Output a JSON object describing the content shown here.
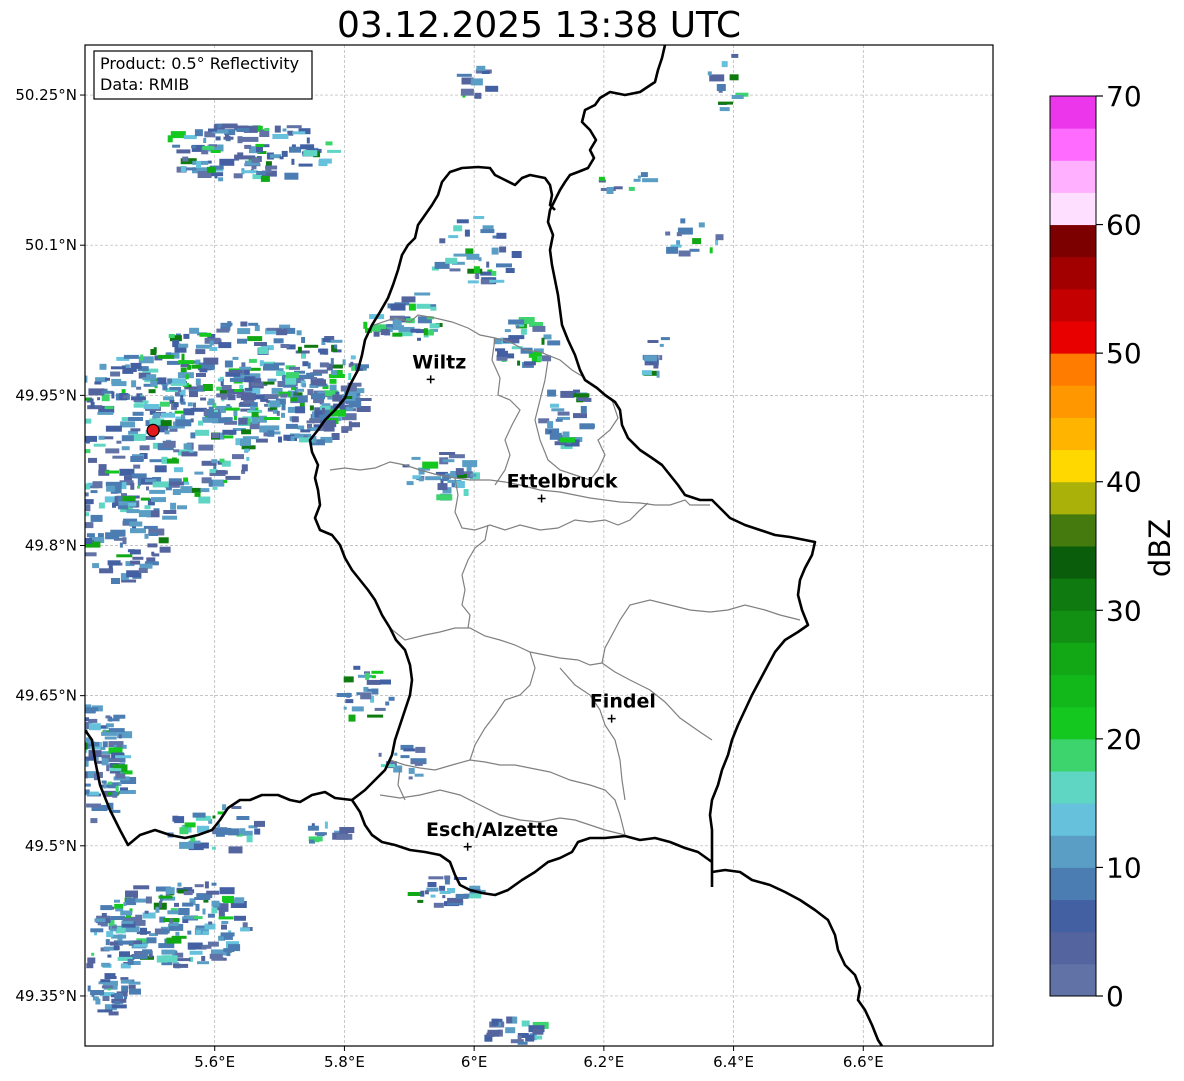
{
  "title": "03.12.2025 13:38 UTC",
  "info_box": {
    "line1": "Product: 0.5° Reflectivity",
    "line2": "Data: RMIB"
  },
  "axes": {
    "lon_range": [
      5.4,
      6.8
    ],
    "lat_range": [
      49.3,
      50.3
    ],
    "x_ticks": [
      {
        "value": 5.6,
        "label": "5.6°E"
      },
      {
        "value": 5.8,
        "label": "5.8°E"
      },
      {
        "value": 6.0,
        "label": "6°E"
      },
      {
        "value": 6.2,
        "label": "6.2°E"
      },
      {
        "value": 6.4,
        "label": "6.4°E"
      },
      {
        "value": 6.6,
        "label": "6.6°E"
      }
    ],
    "y_ticks": [
      {
        "value": 50.25,
        "label": "50.25°N"
      },
      {
        "value": 50.1,
        "label": "50.1°N"
      },
      {
        "value": 49.95,
        "label": "49.95°N"
      },
      {
        "value": 49.8,
        "label": "49.8°N"
      },
      {
        "value": 49.65,
        "label": "49.65°N"
      },
      {
        "value": 49.5,
        "label": "49.5°N"
      },
      {
        "value": 49.35,
        "label": "49.35°N"
      }
    ],
    "grid": true
  },
  "cities": [
    {
      "name": "Wiltz",
      "lon": 5.933,
      "lat": 49.966
    },
    {
      "name": "Ettelbruck",
      "lon": 6.104,
      "lat": 49.847
    },
    {
      "name": "Findel",
      "lon": 6.212,
      "lat": 49.627
    },
    {
      "name": "Esch/Alzette",
      "lon": 5.99,
      "lat": 49.499
    }
  ],
  "radar_site": {
    "lon": 5.505,
    "lat": 49.915,
    "color": "#e41a1c"
  },
  "colorbar": {
    "title": "dBZ",
    "min": 0,
    "max": 70,
    "ticks": [
      0,
      10,
      20,
      30,
      40,
      50,
      60,
      70
    ],
    "tick_labels": [
      "0",
      "10",
      "20",
      "30",
      "40",
      "50",
      "60",
      "70"
    ],
    "colors": [
      "#6173a6",
      "#53649e",
      "#4360a3",
      "#4b7db3",
      "#5a9ec6",
      "#66c2dc",
      "#5fd6c4",
      "#3dd46e",
      "#14c81f",
      "#12b71a",
      "#12a815",
      "#129013",
      "#0e7a10",
      "#0a5e0b",
      "#447a0e",
      "#aab20a",
      "#ffd800",
      "#ffb400",
      "#ff9800",
      "#ff7c00",
      "#e80000",
      "#c40000",
      "#a20000",
      "#7c0000",
      "#ffdfff",
      "#ffb0ff",
      "#ff6bff",
      "#ec36ec"
    ]
  }
}
